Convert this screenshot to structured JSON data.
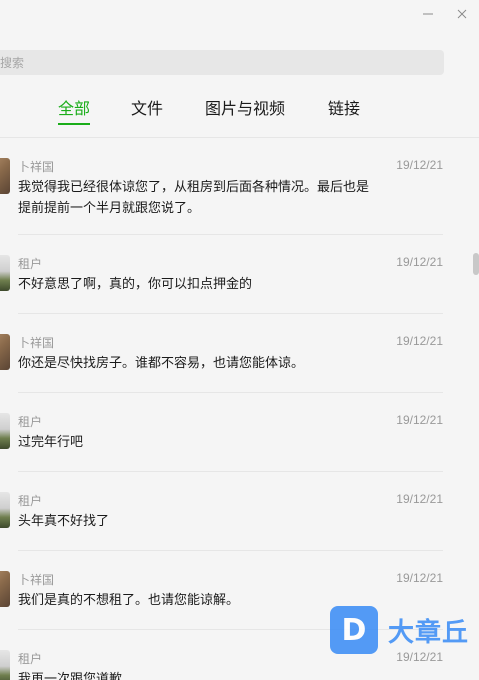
{
  "search": {
    "placeholder": "搜索"
  },
  "tabs": [
    {
      "label": "全部"
    },
    {
      "label": "文件"
    },
    {
      "label": "图片与视频"
    },
    {
      "label": "链接"
    }
  ],
  "messages": [
    {
      "sender": "卜祥国",
      "date": "19/12/21",
      "text": "我觉得我已经很体谅您了，从租房到后面各种情况。最后也是提前提前一个半月就跟您说了。"
    },
    {
      "sender": "租户",
      "date": "19/12/21",
      "text": "不好意思了啊，真的，你可以扣点押金的"
    },
    {
      "sender": "卜祥国",
      "date": "19/12/21",
      "text": "你还是尽快找房子。谁都不容易，也请您能体谅。"
    },
    {
      "sender": "租户",
      "date": "19/12/21",
      "text": "过完年行吧"
    },
    {
      "sender": "租户",
      "date": "19/12/21",
      "text": "头年真不好找了"
    },
    {
      "sender": "卜祥国",
      "date": "19/12/21",
      "text": "我们是真的不想租了。也请您能谅解。"
    },
    {
      "sender": "租户",
      "date": "19/12/21",
      "text": "我再一次跟您道歉"
    }
  ],
  "watermark": {
    "badge": "D",
    "text": "大章丘"
  }
}
